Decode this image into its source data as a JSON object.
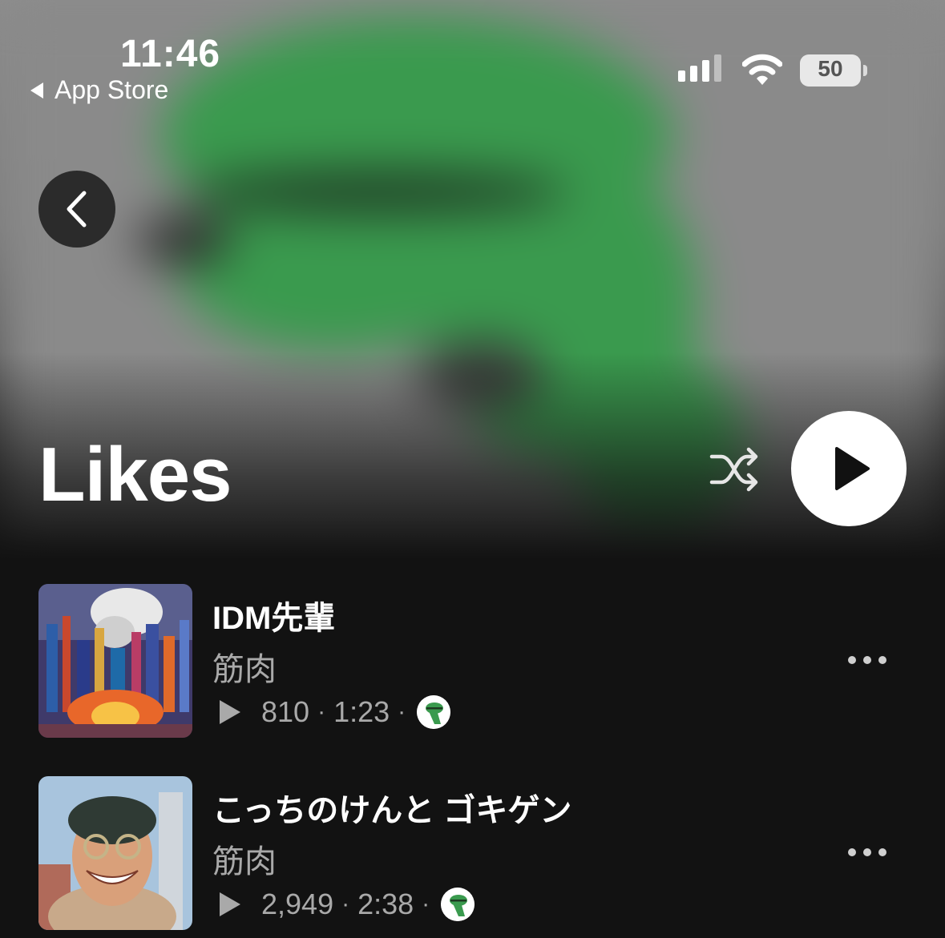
{
  "status_bar": {
    "time": "11:46",
    "back_app_label": "App Store",
    "battery_level": "50"
  },
  "header": {
    "title": "Likes",
    "back_icon": "chevron-left-icon",
    "shuffle_icon": "shuffle-icon",
    "play_icon": "play-icon"
  },
  "tracks": [
    {
      "title": "IDM先輩",
      "artist": "筋肉",
      "plays": "810",
      "duration": "1:23"
    },
    {
      "title": "こっちのけんと ゴキゲン",
      "artist": "筋肉",
      "plays": "2,949",
      "duration": "2:38"
    }
  ],
  "colors": {
    "background": "#121212",
    "secondary_text": "#a9a9a9",
    "hero_green": "#3a9a4e"
  }
}
